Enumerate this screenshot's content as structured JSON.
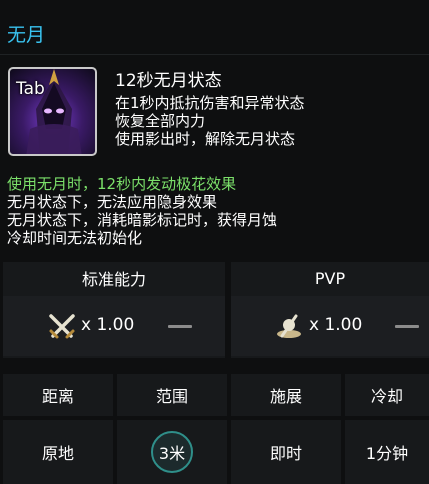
{
  "title": "无月",
  "skill": {
    "icon_label": "Tab",
    "name": "12秒无月状态",
    "desc": [
      "在1秒内抵抗伤害和异常状态",
      "恢复全部内力",
      "使用影出时，解除无月状态"
    ]
  },
  "effects": {
    "highlight": "使用无月时，12秒内发动极花效果",
    "lines": [
      "无月状态下，无法应用隐身效果",
      "无月状态下，消耗暗影标记时，获得月蚀",
      "冷却时间无法初始化"
    ]
  },
  "standard": {
    "header": "标准能力",
    "multiplier": "x 1.00",
    "icon": "crossed-swords-icon"
  },
  "pvp": {
    "header": "PVP",
    "multiplier": "x 1.00",
    "icon": "helmet-sword-icon"
  },
  "stats": {
    "headers": [
      "距离",
      "范围",
      "施展",
      "冷却"
    ],
    "values": [
      "原地",
      "3米",
      "即时",
      "1分钟"
    ]
  },
  "colors": {
    "title": "#39c3f0",
    "highlight": "#7be06a",
    "badge_border": "#2f8f8a"
  }
}
